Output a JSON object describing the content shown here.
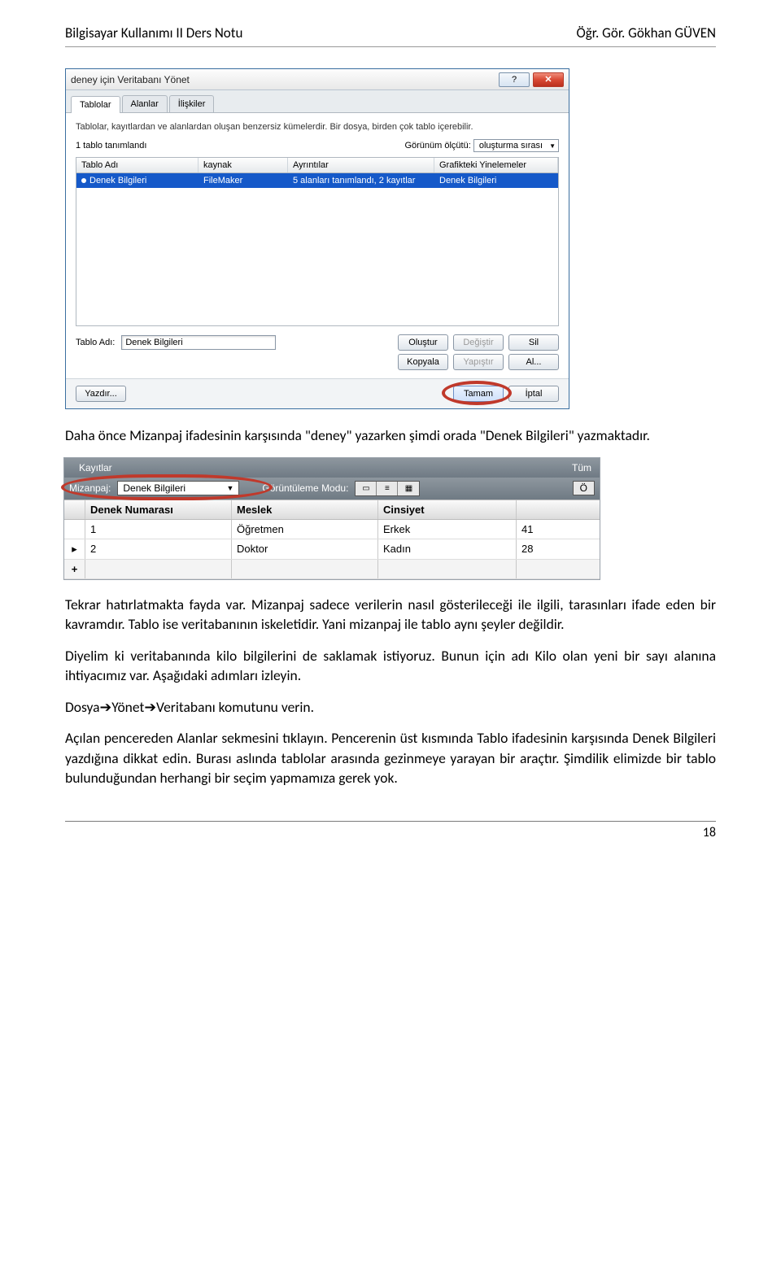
{
  "header": {
    "left": "Bilgisayar Kullanımı II Ders Notu",
    "right": "Öğr. Gör. Gökhan GÜVEN"
  },
  "dialog": {
    "title": "deney için Veritabanı Yönet",
    "tabs": [
      "Tablolar",
      "Alanlar",
      "İlişkiler"
    ],
    "hint": "Tablolar, kayıtlardan ve alanlardan oluşan benzersiz kümelerdir. Bir dosya, birden çok tablo içerebilir.",
    "count_label": "1 tablo tanımlandı",
    "sort_label": "Görünüm ölçütü:",
    "sort_value": "oluşturma sırası",
    "cols": {
      "c1": "Tablo Adı",
      "c2": "kaynak",
      "c3": "Ayrıntılar",
      "c4": "Grafikteki Yinelemeler"
    },
    "row": {
      "name": "Denek Bilgileri",
      "source": "FileMaker",
      "details": "5 alanları tanımlandı, 2 kayıtlar",
      "occ": "Denek Bilgileri"
    },
    "field_label": "Tablo Adı:",
    "field_value": "Denek Bilgileri",
    "buttons": {
      "create": "Oluştur",
      "change": "Değiştir",
      "delete": "Sil",
      "copy": "Kopyala",
      "paste": "Yapıştır",
      "import": "Al...",
      "print": "Yazdır...",
      "ok": "Tamam",
      "cancel": "İptal"
    }
  },
  "para1": "Daha önce Mizanpaj ifadesinin karşısında \"deney\" yazarken şimdi orada \"Denek Bilgileri\" yazmaktadır.",
  "fm": {
    "top_label": "Kayıtlar",
    "top_right": "Tüm",
    "layout_label": "Mizanpaj:",
    "layout_value": "Denek Bilgileri",
    "view_label": "Görüntüleme Modu:",
    "right_btn": "Ö",
    "cols": {
      "c1": "Denek Numarası",
      "c2": "Meslek",
      "c3": "Cinsiyet",
      "c4": ""
    },
    "rows": [
      {
        "marker": "",
        "num": "1",
        "job": "Öğretmen",
        "sex": "Erkek",
        "age": "41"
      },
      {
        "marker": "▸",
        "num": "2",
        "job": "Doktor",
        "sex": "Kadın",
        "age": "28"
      }
    ],
    "plus": "+"
  },
  "para2": "Tekrar hatırlatmakta fayda var. Mizanpaj sadece verilerin nasıl gösterileceği ile ilgili, tarasınları ifade eden bir kavramdır. Tablo ise veritabanının iskeletidir. Yani mizanpaj ile tablo aynı şeyler değildir.",
  "para3": "Diyelim ki veritabanında kilo bilgilerini de saklamak istiyoruz. Bunun için adı Kilo olan yeni bir sayı alanına ihtiyacımız var. Aşağıdaki adımları izleyin.",
  "para4": "Dosya➔Yönet➔Veritabanı komutunu verin.",
  "para5": "Açılan pencereden Alanlar sekmesini tıklayın. Pencerenin üst kısmında Tablo ifadesinin karşısında Denek Bilgileri yazdığına dikkat edin. Burası aslında tablolar arasında gezinmeye yarayan bir araçtır. Şimdilik elimizde bir tablo bulunduğundan herhangi bir seçim yapmamıza gerek yok.",
  "page_number": "18"
}
